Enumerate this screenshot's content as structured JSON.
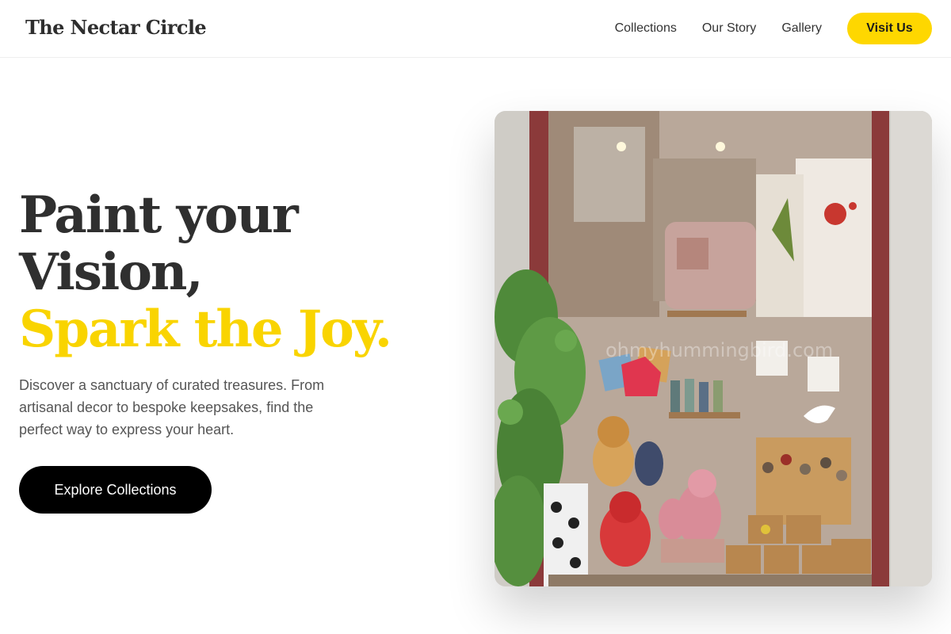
{
  "header": {
    "logo": "The Nectar Circle",
    "nav": [
      {
        "label": "Collections"
      },
      {
        "label": "Our Story"
      },
      {
        "label": "Gallery"
      }
    ],
    "cta_label": "Visit Us"
  },
  "hero": {
    "headline_line1": "Paint your",
    "headline_line2": "Vision,",
    "headline_accent": "Spark the Joy.",
    "description": "Discover a sanctuary of curated treasures. From artisanal decor to bespoke keepsakes, find the perfect way to express your heart.",
    "button_label": "Explore Collections",
    "image_watermark": "ohmyhummingbird.com"
  },
  "colors": {
    "accent": "#fed700",
    "button_dark": "#000000",
    "heading": "#2f2f2f",
    "body_text": "#555555"
  }
}
